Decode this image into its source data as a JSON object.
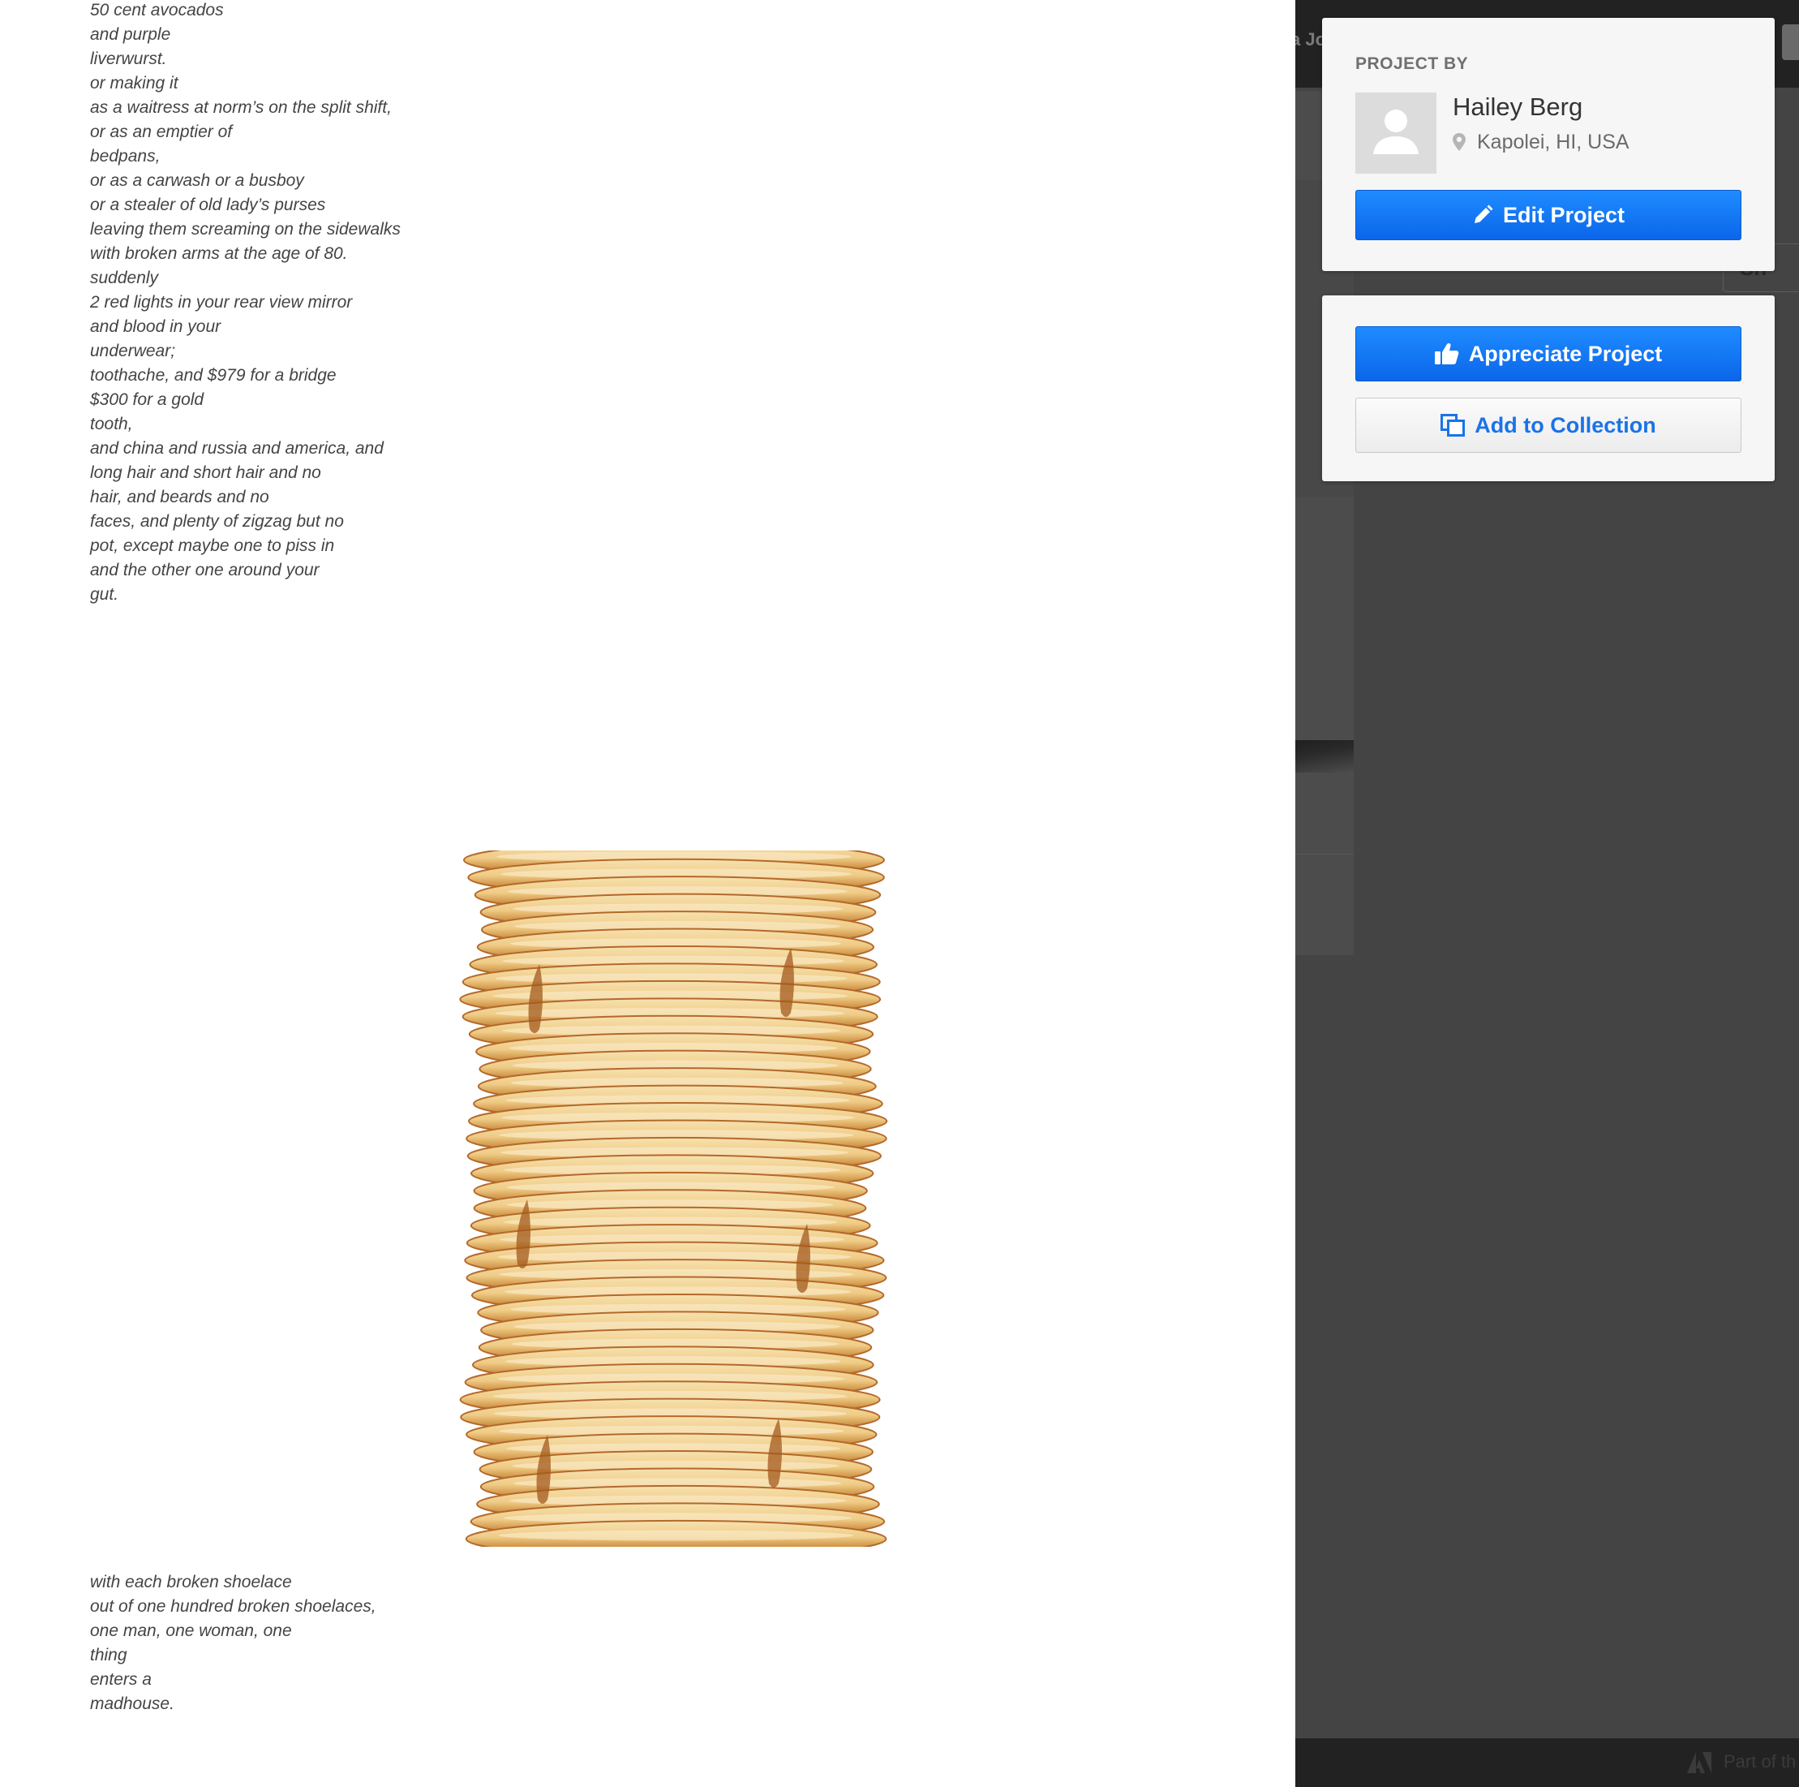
{
  "poem_top": [
    "50 cent avocados",
    "and purple",
    "liverwurst.",
    "or making it",
    "as a waitress at norm’s on the split shift,",
    "or as an emptier of",
    "bedpans,",
    "or as a carwash or a busboy",
    "or a stealer of old lady’s purses",
    "leaving them screaming on the sidewalks",
    "with broken arms at the age of 80.",
    "suddenly",
    "2 red lights in your rear view mirror",
    "and blood in your",
    "underwear;",
    "toothache, and $979 for a bridge",
    "$300 for a gold",
    "tooth,",
    "and china and russia and america, and",
    "long hair and short hair and no",
    "hair, and beards and no",
    "faces, and plenty of zigzag but no",
    "pot, except maybe one to piss in",
    "and the other one around your",
    "gut."
  ],
  "poem_bottom": [
    "with each broken shoelace",
    "out of one hundred broken shoelaces,",
    "one man, one woman, one",
    "thing",
    "enters a",
    "madhouse."
  ],
  "top_bar": {
    "partial_text": "a Jo"
  },
  "ghost_share": {
    "label": "Sh"
  },
  "footer": {
    "partial_text": "Part of th"
  },
  "owner_card": {
    "heading": "PROJECT BY",
    "name": "Hailey Berg",
    "location": "Kapolei, HI, USA",
    "edit_label": "Edit Project"
  },
  "actions_card": {
    "appreciate_label": "Appreciate Project",
    "collection_label": "Add to Collection"
  },
  "colors": {
    "accent_blue": "#1a73e8",
    "sidebar_bg": "#444444",
    "topbar_bg": "#222222",
    "card_bg": "#f6f6f6"
  },
  "icons": [
    "avatar-placeholder-icon",
    "map-pin-icon",
    "pencil-icon",
    "thumbs-up-icon",
    "collection-icon",
    "adobe-icon"
  ]
}
